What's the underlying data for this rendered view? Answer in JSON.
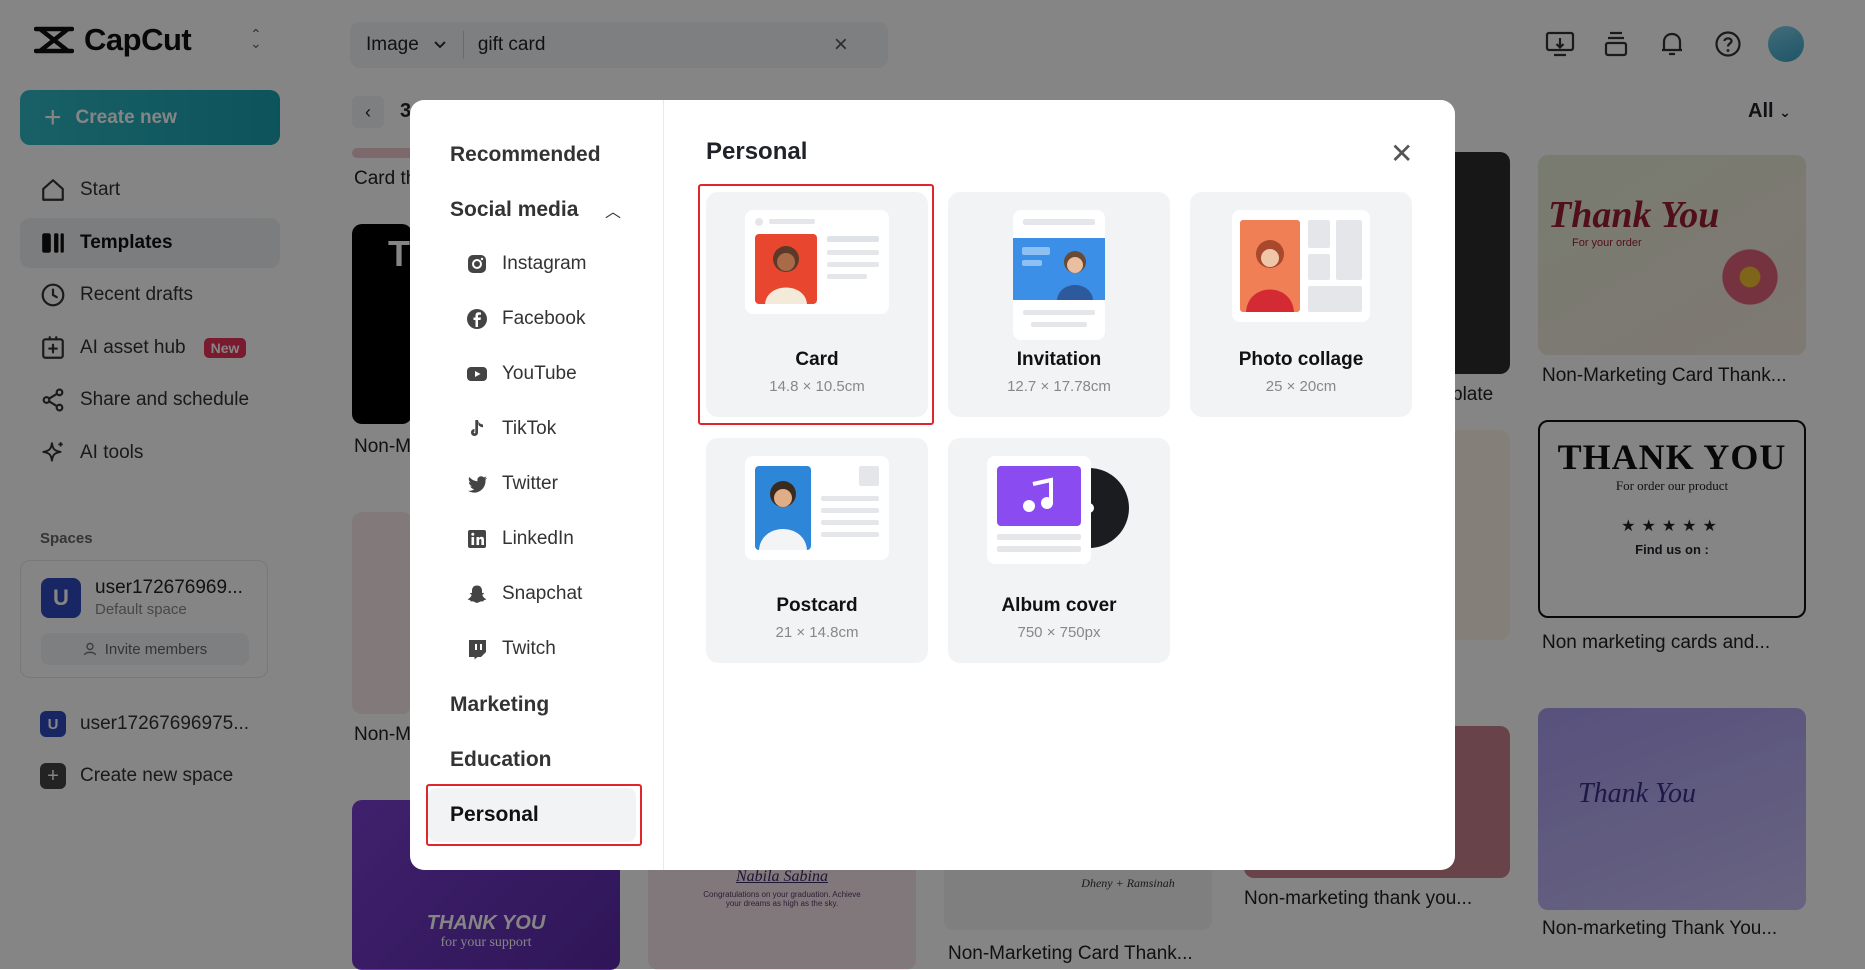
{
  "app": {
    "name": "CapCut"
  },
  "sidebar": {
    "create_label": "Create new",
    "items": [
      {
        "label": "Start",
        "icon": "home-icon"
      },
      {
        "label": "Templates",
        "icon": "templates-icon"
      },
      {
        "label": "Recent drafts",
        "icon": "clock-icon"
      },
      {
        "label": "AI asset hub",
        "icon": "ai-asset-icon",
        "badge": "New"
      },
      {
        "label": "Share and schedule",
        "icon": "share-icon"
      },
      {
        "label": "AI tools",
        "icon": "sparkle-icon"
      }
    ],
    "spaces_title": "Spaces",
    "space": {
      "initial": "U",
      "name": "user172676969...",
      "sub": "Default space",
      "invite_label": "Invite members"
    },
    "other_space": {
      "initial": "U",
      "name": "user17267696975..."
    },
    "create_space_label": "Create new space"
  },
  "topbar": {
    "search_type": "Image",
    "search_value": "gift card",
    "filter_label": "All",
    "result_count": "3"
  },
  "background_tiles": [
    {
      "label": "Card th"
    },
    {
      "label": "Non-M"
    },
    {
      "label": "Non-M"
    },
    {
      "label": "plate"
    },
    {
      "label": "Non-Marketing Card Thank..."
    },
    {
      "label": "Non marketing cards and..."
    },
    {
      "label": "Non-marketing thank you..."
    },
    {
      "label": "Non-marketing Thank You..."
    },
    {
      "label": "Non-Marketing Card Thank..."
    }
  ],
  "tile_text": {
    "thank_you_green": "Thank You",
    "for_your_order": "For your order",
    "thank_you_bold": "THANK YOU",
    "for_order_product": "For order our product",
    "find_us": "Find us on :",
    "thank_you_script": "Thank You",
    "thank_you_support": "THANK YOU",
    "for_your_support": "for your support",
    "nabila": "Nabila Sabina",
    "congrats": "Congratulations on your graduation. Achieve your dreams as high as the sky.",
    "dheny": "Dheny + Ramsinah",
    "black_tile_text": "TI"
  },
  "modal": {
    "categories": {
      "recommended": "Recommended",
      "social_media": "Social media",
      "marketing": "Marketing",
      "education": "Education",
      "personal": "Personal"
    },
    "social_items": [
      {
        "label": "Instagram",
        "icon": "instagram-icon"
      },
      {
        "label": "Facebook",
        "icon": "facebook-icon"
      },
      {
        "label": "YouTube",
        "icon": "youtube-icon"
      },
      {
        "label": "TikTok",
        "icon": "tiktok-icon"
      },
      {
        "label": "Twitter",
        "icon": "twitter-icon"
      },
      {
        "label": "LinkedIn",
        "icon": "linkedin-icon"
      },
      {
        "label": "Snapchat",
        "icon": "snapchat-icon"
      },
      {
        "label": "Twitch",
        "icon": "twitch-icon"
      }
    ],
    "title": "Personal",
    "options": [
      {
        "name": "Card",
        "size": "14.8 × 10.5cm"
      },
      {
        "name": "Invitation",
        "size": "12.7 × 17.78cm"
      },
      {
        "name": "Photo collage",
        "size": "25 × 20cm"
      },
      {
        "name": "Postcard",
        "size": "21 × 14.8cm"
      },
      {
        "name": "Album cover",
        "size": "750 × 750px"
      }
    ]
  },
  "colors": {
    "accent": "#1aa0b0",
    "highlight": "#e0262b",
    "badge": "#e8325a"
  }
}
